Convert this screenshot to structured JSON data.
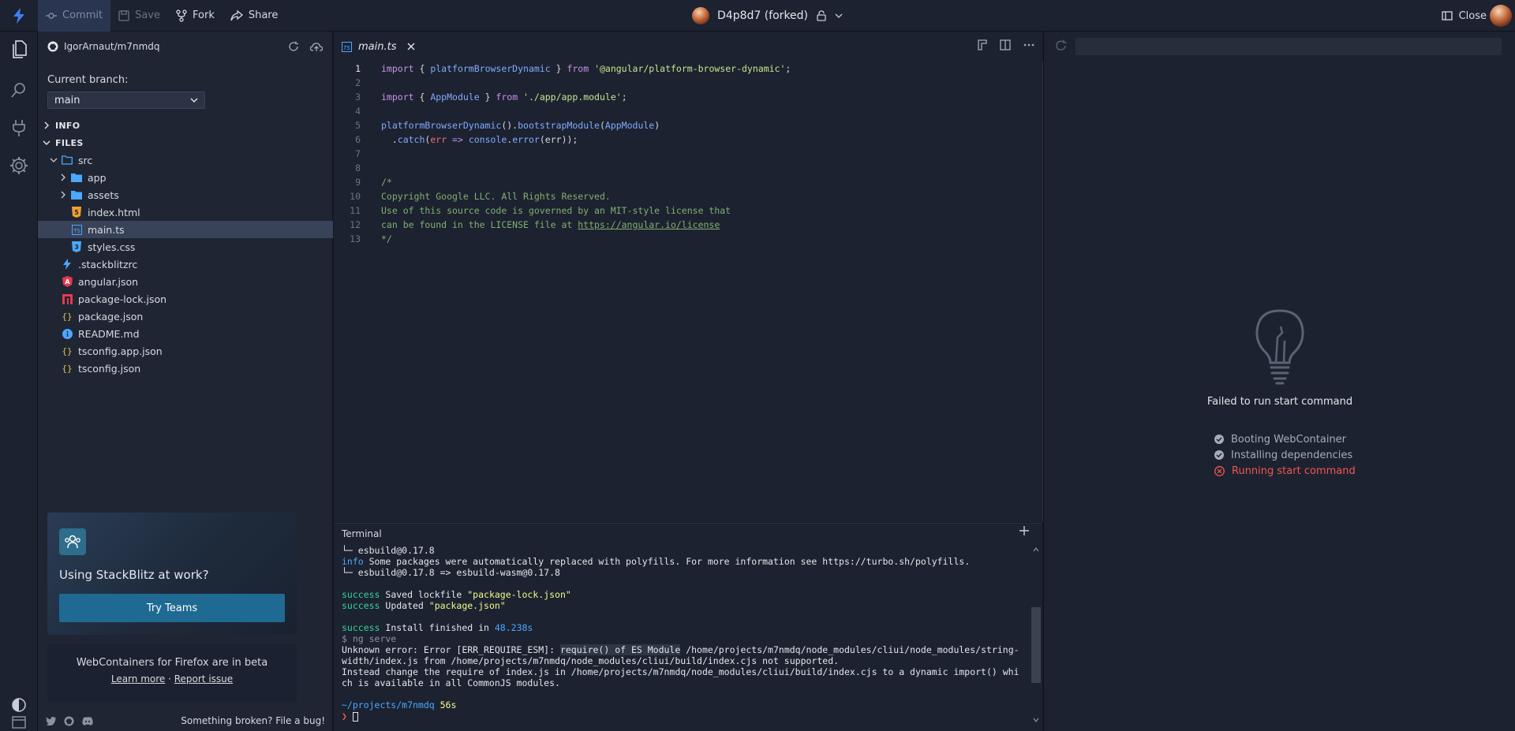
{
  "topbar": {
    "commit_label": "Commit",
    "save_label": "Save",
    "fork_label": "Fork",
    "share_label": "Share",
    "project_name": "D4p8d7 (forked)",
    "close_label": "Close"
  },
  "sidebar": {
    "repo": "IgorArnaut/m7nmdq",
    "branch_label": "Current branch:",
    "branch_value": "main",
    "info_label": "INFO",
    "files_label": "FILES",
    "files": [
      {
        "name": "src",
        "type": "folder-open"
      },
      {
        "name": "app",
        "type": "folder"
      },
      {
        "name": "assets",
        "type": "folder"
      },
      {
        "name": "index.html",
        "type": "html"
      },
      {
        "name": "main.ts",
        "type": "ts"
      },
      {
        "name": "styles.css",
        "type": "css"
      },
      {
        "name": ".stackblitzrc",
        "type": "bolt"
      },
      {
        "name": "angular.json",
        "type": "angular"
      },
      {
        "name": "package-lock.json",
        "type": "npm"
      },
      {
        "name": "package.json",
        "type": "json"
      },
      {
        "name": "README.md",
        "type": "info"
      },
      {
        "name": "tsconfig.app.json",
        "type": "json"
      },
      {
        "name": "tsconfig.json",
        "type": "json"
      }
    ],
    "promo_title": "Using StackBlitz at work?",
    "promo_button": "Try Teams",
    "firefox_title": "WebContainers for Firefox are in beta",
    "learn_more": "Learn more",
    "link_sep": " · ",
    "report_issue": "Report issue",
    "bug_text": "Something broken? File a bug!"
  },
  "editor": {
    "tab_label": "main.ts",
    "line_numbers": [
      "1",
      "2",
      "3",
      "4",
      "5",
      "6",
      "7",
      "8",
      "9",
      "10",
      "11",
      "12",
      "13"
    ],
    "code": {
      "l1_import": "import",
      "l1_brace_open": " { ",
      "l1_id": "platformBrowserDynamic",
      "l1_brace_close": " } ",
      "l1_from": "from",
      "l1_str": " '@angular/platform-browser-dynamic'",
      "l1_semi": ";",
      "l3_import": "import",
      "l3_brace_open": " { ",
      "l3_id": "AppModule",
      "l3_brace_close": " } ",
      "l3_from": "from",
      "l3_str": " './app/app.module'",
      "l3_semi": ";",
      "l5_fn": "platformBrowserDynamic",
      "l5_mid": "().",
      "l5_fn2": "bootstrapModule",
      "l5_paren": "(",
      "l5_arg": "AppModule",
      "l5_close": ")",
      "l6_indent": "  .",
      "l6_catch": "catch",
      "l6_open": "(",
      "l6_err": "err",
      "l6_arrow": " => ",
      "l6_console": "console",
      "l6_dot": ".",
      "l6_error": "error",
      "l6_open2": "(",
      "l6_err2": "err",
      "l6_close": "));",
      "l9": "/*",
      "l10": "Copyright Google LLC. All Rights Reserved.",
      "l11": "Use of this source code is governed by an MIT-style license that",
      "l12_pre": "can be found in the LICENSE file at ",
      "l12_link": "https://angular.io/license",
      "l13": "*/"
    }
  },
  "preview": {
    "fail_text": "Failed to run start command",
    "steps": [
      {
        "label": "Booting WebContainer",
        "status": "done"
      },
      {
        "label": "Installing dependencies",
        "status": "done"
      },
      {
        "label": "Running start command",
        "status": "error"
      }
    ]
  },
  "terminal": {
    "title": "Terminal",
    "l1": "└─ esbuild@0.17.8",
    "l2_tag": "info",
    "l2_text": " Some packages were automatically replaced with polyfills. For more information see https://turbo.sh/polyfills.",
    "l3": "└─ esbuild@0.17.8 => esbuild-wasm@0.17.8",
    "l5_tag": "success",
    "l5_pre": " Saved lockfile ",
    "l5_str": "\"package-lock.json\"",
    "l6_tag": "success",
    "l6_pre": " Updated ",
    "l6_str": "\"package.json\"",
    "l8_tag": "success",
    "l8_pre": " Install finished in ",
    "l8_num": "48.238s",
    "l9": "$ ng serve",
    "l10_pre": "Unknown error: Error [ERR_REQUIRE_ESM]: ",
    "l10_hl": "require() of ES Module",
    "l10_post": " /home/projects/m7nmdq/node_modules/cliui/node_modules/string-",
    "l11": "width/index.js from /home/projects/m7nmdq/node_modules/cliui/build/index.cjs not supported.",
    "l12": "Instead change the require of index.js in /home/projects/m7nmdq/node_modules/cliui/build/index.cjs to a dynamic import() whi",
    "l13": "ch is available in all CommonJS modules.",
    "prompt_path": "~/projects/m7nmdq",
    "prompt_time": " 56s",
    "prompt_char": "❯ "
  },
  "colors": {
    "accent": "#1f6a93",
    "error": "#f0574f",
    "success": "#34d399"
  }
}
